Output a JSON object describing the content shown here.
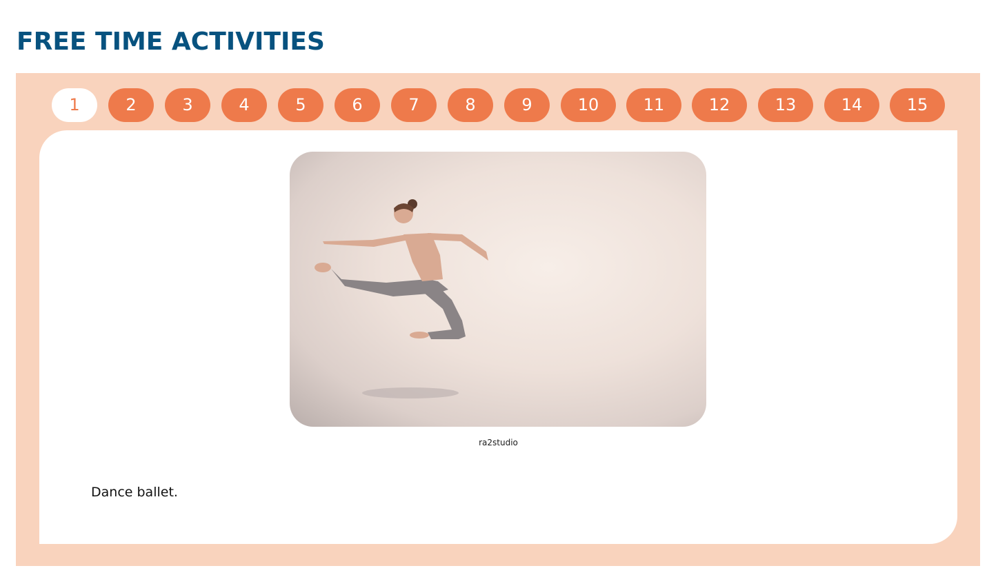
{
  "page": {
    "title": "FREE TIME ACTIVITIES"
  },
  "tabs": [
    {
      "label": "1",
      "active": true
    },
    {
      "label": "2",
      "active": false
    },
    {
      "label": "3",
      "active": false
    },
    {
      "label": "4",
      "active": false
    },
    {
      "label": "5",
      "active": false
    },
    {
      "label": "6",
      "active": false
    },
    {
      "label": "7",
      "active": false
    },
    {
      "label": "8",
      "active": false
    },
    {
      "label": "9",
      "active": false
    },
    {
      "label": "10",
      "active": false
    },
    {
      "label": "11",
      "active": false
    },
    {
      "label": "12",
      "active": false
    },
    {
      "label": "13",
      "active": false
    },
    {
      "label": "14",
      "active": false
    },
    {
      "label": "15",
      "active": false
    }
  ],
  "slide": {
    "image_credit": "ra2studio",
    "caption": "Dance ballet."
  },
  "colors": {
    "title": "#07527f",
    "frame_background": "#f9d3bd",
    "tab_background": "#ee7a4b",
    "tab_active_background": "#ffffff",
    "tab_active_text": "#ee7a4b"
  }
}
